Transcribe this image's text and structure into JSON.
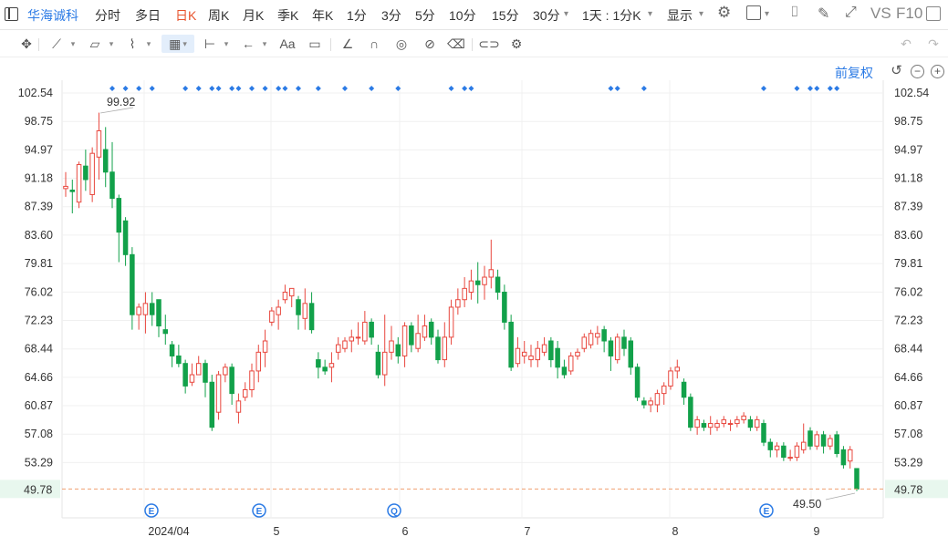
{
  "header": {
    "stock_name": "华海诚科",
    "periods": [
      "分时",
      "多日",
      "日K",
      "周K",
      "月K",
      "季K",
      "年K",
      "1分",
      "3分",
      "5分",
      "10分",
      "15分",
      "30分"
    ],
    "active_period": "日K",
    "range_select": "1天 : 1分K",
    "display_label": "显示",
    "vs_label": "VS",
    "f10_label": "F10"
  },
  "toolbar": {
    "tools": [
      "move-icon",
      "line-icon",
      "channel-icon",
      "wave-icon",
      "fib-icon",
      "range-icon",
      "arrow-icon",
      "text-icon",
      "comment-icon",
      "angle-icon",
      "magnet-icon",
      "hide-icon",
      "eye-off-icon",
      "delete-icon",
      "link-icon",
      "settings-icon",
      "undo-icon",
      "redo-icon"
    ],
    "text_tool_label": "Aa"
  },
  "adjust_label": "前复权",
  "colors": {
    "up": "#e8473e",
    "down": "#12a14a",
    "event": "#2c7be5",
    "last": "#f0a070"
  },
  "chart_data": {
    "type": "candlestick",
    "y_ticks": [
      102.54,
      98.75,
      94.97,
      91.18,
      87.39,
      83.6,
      79.81,
      76.02,
      72.23,
      68.44,
      64.66,
      60.87,
      57.08,
      53.29
    ],
    "ylim": [
      49.0,
      103.0
    ],
    "x_labels": [
      "2024/04",
      "5",
      "6",
      "7",
      "8",
      "9"
    ],
    "high_label": "99.92",
    "low_label": "49.50",
    "last_price": "49.78",
    "event_markers": [
      "E",
      "E",
      "Q",
      "E"
    ],
    "candles": [
      [
        89.8,
        90.1,
        88.7,
        92.0
      ],
      [
        89.6,
        89.4,
        86.5,
        91.0
      ],
      [
        88.0,
        93.0,
        87.2,
        93.4
      ],
      [
        92.8,
        91.0,
        89.5,
        95.0
      ],
      [
        89.0,
        94.5,
        88.0,
        95.3
      ],
      [
        94.0,
        97.5,
        91.0,
        99.92
      ],
      [
        95.0,
        92.0,
        90.0,
        98.0
      ],
      [
        92.0,
        88.5,
        87.2,
        96.0
      ],
      [
        88.5,
        84.0,
        80.0,
        89.0
      ],
      [
        85.5,
        81.0,
        79.5,
        86.0
      ],
      [
        81.0,
        73.0,
        71.0,
        82.0
      ],
      [
        73.0,
        74.0,
        71.0,
        74.5
      ],
      [
        73.0,
        74.5,
        70.5,
        76.0
      ],
      [
        74.5,
        73.0,
        71.5,
        76.0
      ],
      [
        75.0,
        71.5,
        70.0,
        75.0
      ],
      [
        71.0,
        70.5,
        69.0,
        73.0
      ],
      [
        69.0,
        67.5,
        66.0,
        69.5
      ],
      [
        67.5,
        66.5,
        66.0,
        69.0
      ],
      [
        66.5,
        63.5,
        62.5,
        67.0
      ],
      [
        64.0,
        65.0,
        63.5,
        66.5
      ],
      [
        65.0,
        66.5,
        65.0,
        67.5
      ],
      [
        66.5,
        64.0,
        62.0,
        67.0
      ],
      [
        64.0,
        58.0,
        57.5,
        65.0
      ],
      [
        60.0,
        65.0,
        59.0,
        65.5
      ],
      [
        65.0,
        66.0,
        64.0,
        66.5
      ],
      [
        66.0,
        62.5,
        61.0,
        66.5
      ],
      [
        60.0,
        61.5,
        58.5,
        62.5
      ],
      [
        62.0,
        63.0,
        61.5,
        64.0
      ],
      [
        63.0,
        65.5,
        62.0,
        66.5
      ],
      [
        65.5,
        68.0,
        64.0,
        69.0
      ],
      [
        68.0,
        69.5,
        66.0,
        71.0
      ],
      [
        72.0,
        73.5,
        71.5,
        74.0
      ],
      [
        73.0,
        74.0,
        71.0,
        75.0
      ],
      [
        75.0,
        76.0,
        74.5,
        77.0
      ],
      [
        75.5,
        76.5,
        74.0,
        76.5
      ],
      [
        75.0,
        73.0,
        71.0,
        75.5
      ],
      [
        72.5,
        74.5,
        71.0,
        76.5
      ],
      [
        74.5,
        71.0,
        70.5,
        76.0
      ],
      [
        67.0,
        66.0,
        64.5,
        68.0
      ],
      [
        66.0,
        65.5,
        65.0,
        67.0
      ],
      [
        66.0,
        66.5,
        64.0,
        68.0
      ],
      [
        68.0,
        69.0,
        67.0,
        70.0
      ],
      [
        68.5,
        69.5,
        68.0,
        70.0
      ],
      [
        69.5,
        70.0,
        68.0,
        71.0
      ],
      [
        70.0,
        70.0,
        69.0,
        72.0
      ],
      [
        69.5,
        72.0,
        69.0,
        73.5
      ],
      [
        72.0,
        70.0,
        69.0,
        72.5
      ],
      [
        68.0,
        65.0,
        64.5,
        69.0
      ],
      [
        65.0,
        68.0,
        63.5,
        73.0
      ],
      [
        68.0,
        69.5,
        67.0,
        71.5
      ],
      [
        69.0,
        67.5,
        66.5,
        70.0
      ],
      [
        67.5,
        71.5,
        66.0,
        72.0
      ],
      [
        71.5,
        69.0,
        68.0,
        72.0
      ],
      [
        68.5,
        70.5,
        68.0,
        73.0
      ],
      [
        70.0,
        71.5,
        69.5,
        73.0
      ],
      [
        72.0,
        70.0,
        69.0,
        72.5
      ],
      [
        70.0,
        67.0,
        66.5,
        71.0
      ],
      [
        67.0,
        70.0,
        66.0,
        72.0
      ],
      [
        70.0,
        74.0,
        69.0,
        75.0
      ],
      [
        74.0,
        75.0,
        73.0,
        76.5
      ],
      [
        75.0,
        76.5,
        74.0,
        78.0
      ],
      [
        76.0,
        77.5,
        75.0,
        79.0
      ],
      [
        77.5,
        77.0,
        74.5,
        80.0
      ],
      [
        77.0,
        78.0,
        75.0,
        79.5
      ],
      [
        78.0,
        79.0,
        76.5,
        83.0
      ],
      [
        78.0,
        76.0,
        75.0,
        79.0
      ],
      [
        76.0,
        72.0,
        71.0,
        77.0
      ],
      [
        72.0,
        66.0,
        65.5,
        73.0
      ],
      [
        66.5,
        68.5,
        66.0,
        70.0
      ],
      [
        67.5,
        68.0,
        66.5,
        69.5
      ],
      [
        67.0,
        67.5,
        66.0,
        69.0
      ],
      [
        67.0,
        68.5,
        66.0,
        69.5
      ],
      [
        68.0,
        69.0,
        67.5,
        70.0
      ],
      [
        69.5,
        67.0,
        66.0,
        70.0
      ],
      [
        68.5,
        66.0,
        64.5,
        69.5
      ],
      [
        66.0,
        65.0,
        64.5,
        67.0
      ],
      [
        65.5,
        67.5,
        65.0,
        68.0
      ],
      [
        67.5,
        68.0,
        67.0,
        68.5
      ],
      [
        68.5,
        70.0,
        68.0,
        70.5
      ],
      [
        69.0,
        70.5,
        68.5,
        71.0
      ],
      [
        70.0,
        70.5,
        69.0,
        71.5
      ],
      [
        71.0,
        69.5,
        68.0,
        71.5
      ],
      [
        69.5,
        67.5,
        65.5,
        70.0
      ],
      [
        67.0,
        70.0,
        66.5,
        70.5
      ],
      [
        70.0,
        68.5,
        67.5,
        71.0
      ],
      [
        69.5,
        66.0,
        65.0,
        70.0
      ],
      [
        66.0,
        62.0,
        61.5,
        66.5
      ],
      [
        61.5,
        61.0,
        60.5,
        62.0
      ],
      [
        61.0,
        61.5,
        60.0,
        62.0
      ],
      [
        61.0,
        62.5,
        60.0,
        63.0
      ],
      [
        62.5,
        63.5,
        61.0,
        64.0
      ],
      [
        63.5,
        65.5,
        63.0,
        66.0
      ],
      [
        65.5,
        66.0,
        64.5,
        67.0
      ],
      [
        64.0,
        62.0,
        61.0,
        64.5
      ],
      [
        62.0,
        58.0,
        57.5,
        62.5
      ],
      [
        58.0,
        59.0,
        57.0,
        59.5
      ],
      [
        58.5,
        58.0,
        57.5,
        59.0
      ],
      [
        58.0,
        58.5,
        57.0,
        59.5
      ],
      [
        58.0,
        58.5,
        57.5,
        59.0
      ],
      [
        58.5,
        59.0,
        58.0,
        59.5
      ],
      [
        58.5,
        58.5,
        57.5,
        59.0
      ],
      [
        58.5,
        59.0,
        58.0,
        59.5
      ],
      [
        59.0,
        59.5,
        58.5,
        60.0
      ],
      [
        59.0,
        58.0,
        57.5,
        59.5
      ],
      [
        58.0,
        59.0,
        57.5,
        59.5
      ],
      [
        58.5,
        56.0,
        55.5,
        59.0
      ],
      [
        56.0,
        55.0,
        54.0,
        56.5
      ],
      [
        55.0,
        55.5,
        54.0,
        56.0
      ],
      [
        55.5,
        54.0,
        53.5,
        56.0
      ],
      [
        54.0,
        54.0,
        53.5,
        55.0
      ],
      [
        54.0,
        55.5,
        53.5,
        56.0
      ],
      [
        55.0,
        56.0,
        54.5,
        58.5
      ],
      [
        57.5,
        55.5,
        55.0,
        58.0
      ],
      [
        55.5,
        57.0,
        55.0,
        57.5
      ],
      [
        57.0,
        55.5,
        54.5,
        57.5
      ],
      [
        55.5,
        56.5,
        55.0,
        57.0
      ],
      [
        57.0,
        54.5,
        54.0,
        57.5
      ],
      [
        55.0,
        53.0,
        52.5,
        55.5
      ],
      [
        53.5,
        55.0,
        52.5,
        55.5
      ],
      [
        52.5,
        49.78,
        49.5,
        52.5
      ]
    ]
  }
}
